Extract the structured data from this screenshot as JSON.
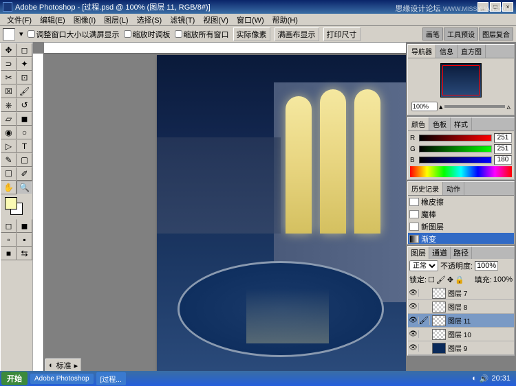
{
  "title": "Adobe Photoshop - [过程.psd @ 100% (图层 11, RGB/8#)]",
  "watermark": {
    "main": "思缘设计论坛",
    "sub": "WWW.MISSYUAN.COM"
  },
  "menu": [
    "文件(F)",
    "编辑(E)",
    "图像(I)",
    "图层(L)",
    "选择(S)",
    "滤镜(T)",
    "视图(V)",
    "窗口(W)",
    "帮助(H)"
  ],
  "options": {
    "cb1": "调整窗口大小以满屏显示",
    "cb2": "缩放时调板",
    "cb3": "缩放所有窗口",
    "btn1": "实际像素",
    "btn2": "满画布显示",
    "btn3": "打印尺寸",
    "tabs": [
      "画笔",
      "工具预设",
      "图层复合"
    ]
  },
  "doc_status": {
    "label": "标准"
  },
  "navigator": {
    "tabs": [
      "导航器",
      "信息",
      "直方图"
    ],
    "zoom": "100%"
  },
  "color": {
    "tabs": [
      "颜色",
      "色板",
      "样式"
    ],
    "r": "251",
    "g": "251",
    "b": "180",
    "fg": "#fbfbb4"
  },
  "history": {
    "tabs": [
      "历史记录",
      "动作"
    ],
    "items": [
      {
        "name": "橡皮擦"
      },
      {
        "name": "魔棒"
      },
      {
        "name": "新图层"
      },
      {
        "name": "渐变",
        "active": true
      }
    ]
  },
  "layers": {
    "tabs": [
      "图层",
      "通道",
      "路径"
    ],
    "blend": "正常",
    "opacity_label": "不透明度:",
    "opacity": "100%",
    "lock_label": "锁定:",
    "fill_label": "填充:",
    "fill": "100%",
    "items": [
      {
        "name": "图层 7"
      },
      {
        "name": "图层 8"
      },
      {
        "name": "图层 11",
        "active": true
      },
      {
        "name": "图层 10"
      },
      {
        "name": "图层 9"
      }
    ]
  },
  "taskbar": {
    "start": "开始",
    "tasks": [
      "Adobe Photoshop",
      "[过程..."
    ],
    "time": "20:31"
  }
}
